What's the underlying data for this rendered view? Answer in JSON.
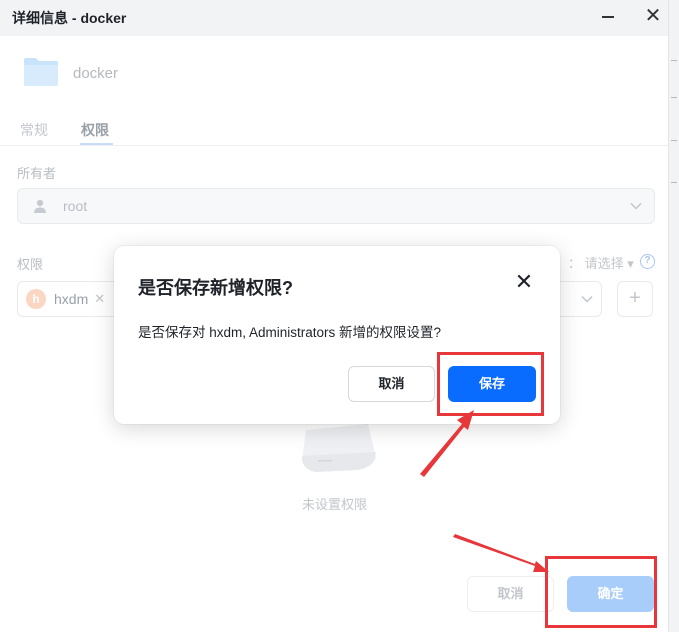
{
  "window": {
    "title": "详细信息 - docker",
    "folder_name": "docker"
  },
  "tabs": [
    {
      "label": "常规",
      "active": false
    },
    {
      "label": "权限",
      "active": true
    }
  ],
  "owner": {
    "label": "所有者",
    "value": "root"
  },
  "permissions": {
    "label": "权限",
    "hint_suffix": "： 请选择 ▾",
    "tag_avatar": "h",
    "tag_label": "hxdm",
    "add_symbol": "+",
    "empty_text": "未设置权限"
  },
  "footer": {
    "cancel_label": "取消",
    "ok_label": "确定"
  },
  "dialog": {
    "title": "是否保存新增权限?",
    "message": "是否保存对 hxdm, Administrators 新增的权限设置?",
    "cancel_label": "取消",
    "save_label": "保存"
  },
  "colors": {
    "primary": "#0a6cff",
    "primary_disabled": "#a9cdfb",
    "annotation_red": "#e8373a",
    "titlebar_bg": "#f2f3f5"
  },
  "icons": {
    "close": "close-icon",
    "minimize": "minimize-icon",
    "folder": "folder-icon",
    "user": "user-icon",
    "help": "help-icon",
    "chevron": "chevron-down-icon"
  }
}
